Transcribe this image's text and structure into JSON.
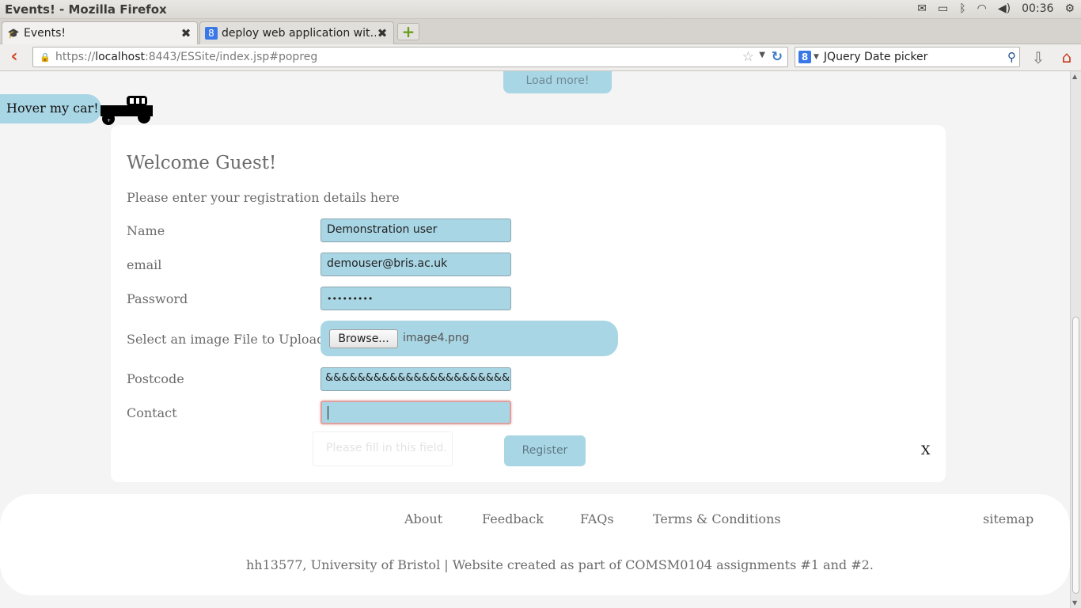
{
  "window": {
    "title": "Events! - Mozilla Firefox",
    "clock": "00:36"
  },
  "tray_icons": [
    "mail-icon",
    "battery-icon",
    "bluetooth-icon",
    "wifi-icon",
    "volume-icon",
    "power-icon"
  ],
  "tabs": [
    {
      "label": "Events!",
      "active": true
    },
    {
      "label": "deploy web application wit…",
      "active": false
    }
  ],
  "navbar": {
    "url_prefix": "https://",
    "url_host": "localhost",
    "url_rest": ":8443/ESSite/index.jsp#popreg",
    "search_engine": "8",
    "search_query": "JQuery Date picker"
  },
  "page": {
    "load_more": "Load more!",
    "hover_car": "Hover my car!",
    "welcome": "Welcome Guest!",
    "subtitle": "Please enter your registration details here",
    "form": {
      "name_label": "Name",
      "name_value": "Demonstration user",
      "email_label": "email",
      "email_value": "demouser@bris.ac.uk",
      "password_label": "Password",
      "password_value": "•••••••••",
      "file_label": "Select an image File to Upload",
      "browse_label": "Browse...",
      "file_name": "image4.png",
      "postcode_label": "Postcode",
      "postcode_value": "&&&&&&&&&&&&&&&&&&&&&&&",
      "contact_label": "Contact",
      "contact_value": "",
      "validation_tooltip": "Please fill in this field.",
      "register_label": "Register",
      "close_label": "X"
    },
    "footer": {
      "links": [
        "About",
        "Feedback",
        "FAQs",
        "Terms & Conditions"
      ],
      "sitemap": "sitemap",
      "credit": "hh13577, University of Bristol | Website created as part of COMSM0104 assignments #1 and #2."
    }
  },
  "colors": {
    "accent": "#a9d6e5",
    "text": "#6b6b6b",
    "error_border": "#e0a0a0"
  }
}
